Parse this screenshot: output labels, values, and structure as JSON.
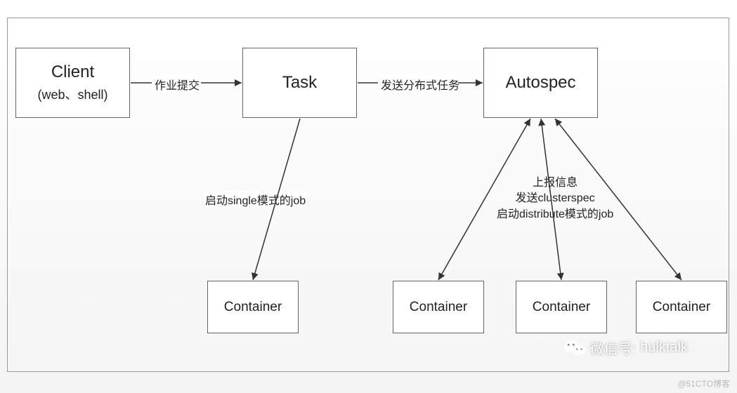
{
  "boxes": {
    "client": {
      "title": "Client",
      "sub": "(web、shell)"
    },
    "task": {
      "title": "Task"
    },
    "autospec": {
      "title": "Autospec"
    },
    "container": "Container"
  },
  "edges": {
    "submit": "作业提交",
    "send_dist": "发送分布式任务",
    "start_single": "启动single模式的job",
    "report_line1": "上报信息",
    "report_line2": "发送clusterspec",
    "report_line3": "启动distribute模式的job"
  },
  "watermark": {
    "prefix": "微信号:",
    "id": "hulktalk"
  },
  "blog": "@51CTO博客"
}
